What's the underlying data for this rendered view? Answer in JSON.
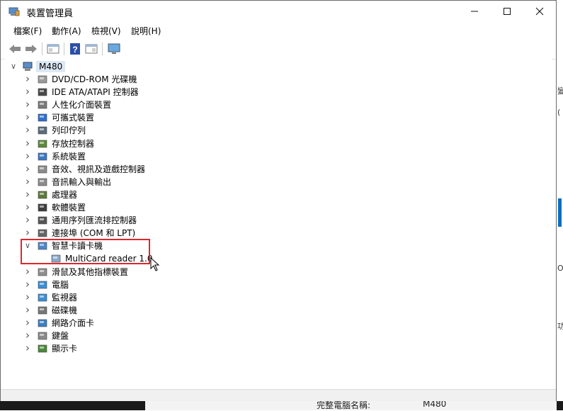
{
  "window": {
    "title": "裝置管理員"
  },
  "menu": [
    "檔案(F)",
    "動作(A)",
    "檢視(V)",
    "說明(H)"
  ],
  "toolbar": [
    "back-icon",
    "forward-icon",
    "properties-icon",
    "help-icon",
    "show-hidden-icon",
    "monitor-icon"
  ],
  "tree": {
    "root": "M480",
    "items": [
      {
        "label": "DVD/CD-ROM 光碟機",
        "icon": "dvd-icon",
        "expanded": false
      },
      {
        "label": "IDE ATA/ATAPI 控制器",
        "icon": "ide-controller-icon",
        "expanded": false
      },
      {
        "label": "人性化介面裝置",
        "icon": "hid-icon",
        "expanded": false
      },
      {
        "label": "可攜式裝置",
        "icon": "portable-device-icon",
        "expanded": false
      },
      {
        "label": "列印佇列",
        "icon": "printer-icon",
        "expanded": false
      },
      {
        "label": "存放控制器",
        "icon": "storage-controller-icon",
        "expanded": false
      },
      {
        "label": "系統裝置",
        "icon": "system-device-icon",
        "expanded": false
      },
      {
        "label": "音效、視訊及遊戲控制器",
        "icon": "speaker-icon",
        "expanded": false
      },
      {
        "label": "音訊輸入與輸出",
        "icon": "audio-io-icon",
        "expanded": false
      },
      {
        "label": "處理器",
        "icon": "processor-icon",
        "expanded": false
      },
      {
        "label": "軟體裝置",
        "icon": "software-device-icon",
        "expanded": false
      },
      {
        "label": "通用序列匯流排控制器",
        "icon": "usb-icon",
        "expanded": false
      },
      {
        "label": "連接埠 (COM 和 LPT)",
        "icon": "port-icon",
        "expanded": false
      },
      {
        "label": "智慧卡讀卡機",
        "icon": "smartcard-reader-icon",
        "expanded": true
      },
      {
        "label": "MultiCard reader 1.0",
        "icon": "card-reader-device-icon",
        "child": true
      },
      {
        "label": "滑鼠及其他指標裝置",
        "icon": "mouse-icon",
        "expanded": false
      },
      {
        "label": "電腦",
        "icon": "computer-icon",
        "expanded": false
      },
      {
        "label": "監視器",
        "icon": "monitor-device-icon",
        "expanded": false
      },
      {
        "label": "磁碟機",
        "icon": "disk-drive-icon",
        "expanded": false
      },
      {
        "label": "網路介面卡",
        "icon": "network-adapter-icon",
        "expanded": false
      },
      {
        "label": "鍵盤",
        "icon": "keyboard-icon",
        "expanded": false
      },
      {
        "label": "顯示卡",
        "icon": "display-adapter-icon",
        "expanded": false
      }
    ]
  },
  "background": {
    "bottom_left": "完整電腦名稱:",
    "bottom_right": "M480",
    "right_fragments": [
      "變",
      "(",
      "O",
      "功"
    ]
  }
}
